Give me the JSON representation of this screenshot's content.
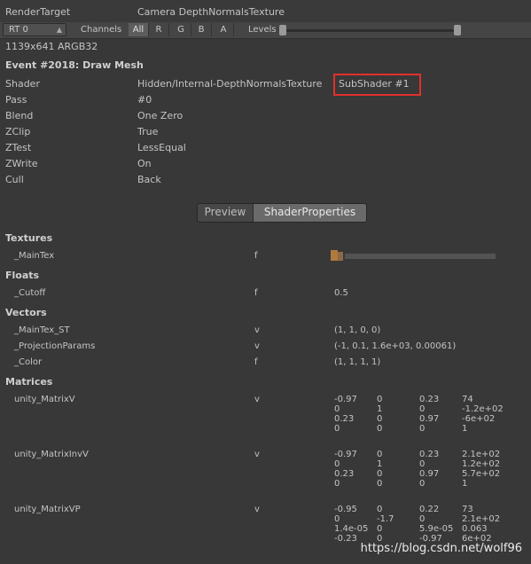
{
  "header": {
    "left_label": "RenderTarget",
    "camera_label": "Camera DepthNormalsTexture"
  },
  "toolbar": {
    "rt_value": "RT 0",
    "channels_label": "Channels",
    "channels": [
      "All",
      "R",
      "G",
      "B",
      "A"
    ],
    "levels_label": "Levels",
    "levels_min": 0,
    "levels_max": 1
  },
  "resolution": "1139x641 ARGB32",
  "event": {
    "title": "Event #2018: Draw Mesh",
    "props": [
      {
        "name": "Shader",
        "value": "Hidden/Internal-DepthNormalsTexture",
        "extra": "SubShader #1"
      },
      {
        "name": "Pass",
        "value": "#0"
      },
      {
        "name": "Blend",
        "value": "One Zero"
      },
      {
        "name": "ZClip",
        "value": "True"
      },
      {
        "name": "ZTest",
        "value": "LessEqual"
      },
      {
        "name": "ZWrite",
        "value": "On"
      },
      {
        "name": "Cull",
        "value": "Back"
      }
    ]
  },
  "tabs": [
    "Preview",
    "ShaderProperties"
  ],
  "selected_tab": "ShaderProperties",
  "textures": {
    "title": "Textures",
    "rows": [
      {
        "name": "_MainTex",
        "type": "f"
      }
    ]
  },
  "floats": {
    "title": "Floats",
    "rows": [
      {
        "name": "_Cutoff",
        "type": "f",
        "value": "0.5"
      }
    ]
  },
  "vectors": {
    "title": "Vectors",
    "rows": [
      {
        "name": "_MainTex_ST",
        "type": "v",
        "value": "(1, 1, 0, 0)"
      },
      {
        "name": "_ProjectionParams",
        "type": "v",
        "value": "(-1, 0.1, 1.6e+03, 0.00061)"
      },
      {
        "name": "_Color",
        "type": "f",
        "value": "(1, 1, 1, 1)"
      }
    ]
  },
  "matrices": {
    "title": "Matrices",
    "rows": [
      {
        "name": "unity_MatrixV",
        "type": "v",
        "cells": [
          [
            "-0.97",
            "0",
            "0.23",
            "74"
          ],
          [
            "0",
            "1",
            "0",
            "-1.2e+02"
          ],
          [
            "0.23",
            "0",
            "0.97",
            "-6e+02"
          ],
          [
            "0",
            "0",
            "0",
            "1"
          ]
        ]
      },
      {
        "name": "unity_MatrixInvV",
        "type": "v",
        "cells": [
          [
            "-0.97",
            "0",
            "0.23",
            "2.1e+02"
          ],
          [
            "0",
            "1",
            "0",
            "1.2e+02"
          ],
          [
            "0.23",
            "0",
            "0.97",
            "5.7e+02"
          ],
          [
            "0",
            "0",
            "0",
            "1"
          ]
        ]
      },
      {
        "name": "unity_MatrixVP",
        "type": "v",
        "cells": [
          [
            "-0.95",
            "0",
            "0.22",
            "73"
          ],
          [
            "0",
            "-1.7",
            "0",
            "2.1e+02"
          ],
          [
            "1.4e-05",
            "0",
            "5.9e-05",
            "0.063"
          ],
          [
            "-0.23",
            "0",
            "-0.97",
            "6e+02"
          ]
        ]
      }
    ]
  },
  "watermark": "https://blog.csdn.net/wolf96",
  "colors": {
    "background": "#383838",
    "highlight_box": "#e0302c"
  }
}
